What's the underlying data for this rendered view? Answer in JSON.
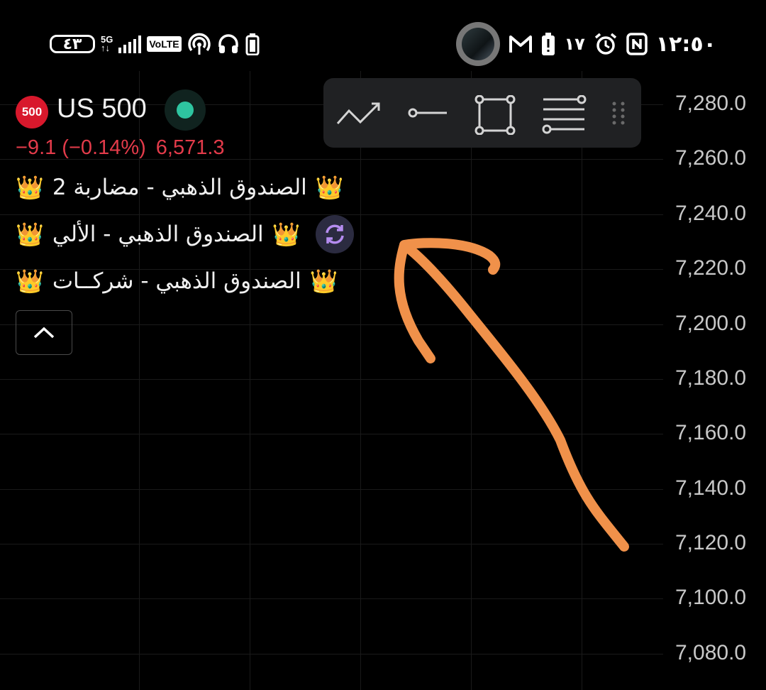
{
  "status_bar": {
    "battery_percent": "٤٣",
    "network": "5G",
    "volte": "VoLTE",
    "time": "١٢:٥٠",
    "date": "١٧",
    "icons": [
      "battery-icon",
      "signal-icon",
      "volte-icon",
      "hotspot-icon",
      "headphones-icon",
      "battery-full-icon",
      "notification-avatar",
      "gmail-icon",
      "battery-alert-icon",
      "alarm-icon",
      "nfc-icon"
    ]
  },
  "symbol": {
    "badge": "500",
    "name": "US 500",
    "change": "−9.1 (−0.14%)",
    "last_price": "6,571.3",
    "market_status_color": "#2ec4a0",
    "change_color": "#e33b4a"
  },
  "indicators": [
    {
      "label": "الصندوق الذهبي - مضاربة 2",
      "icon": "crown-icon"
    },
    {
      "label": "الصندوق الذهبي - الألي",
      "icon": "crown-icon",
      "has_refresh": true
    },
    {
      "label": "الصندوق الذهبي - شركــات",
      "icon": "crown-icon"
    }
  ],
  "drawing_toolbar": {
    "tools": [
      "trend-line-icon",
      "horizontal-ray-icon",
      "rectangle-icon",
      "fib-retracement-icon",
      "drag-handle-icon"
    ]
  },
  "price_axis": {
    "labels": [
      "7,280.0",
      "7,260.0",
      "7,240.0",
      "7,220.0",
      "7,200.0",
      "7,180.0",
      "7,160.0",
      "7,140.0",
      "7,120.0",
      "7,100.0",
      "7,080.0"
    ]
  },
  "annotation": {
    "color": "#f0914a",
    "shape": "hand-drawn arrow pointing up-left at the refresh icon"
  }
}
